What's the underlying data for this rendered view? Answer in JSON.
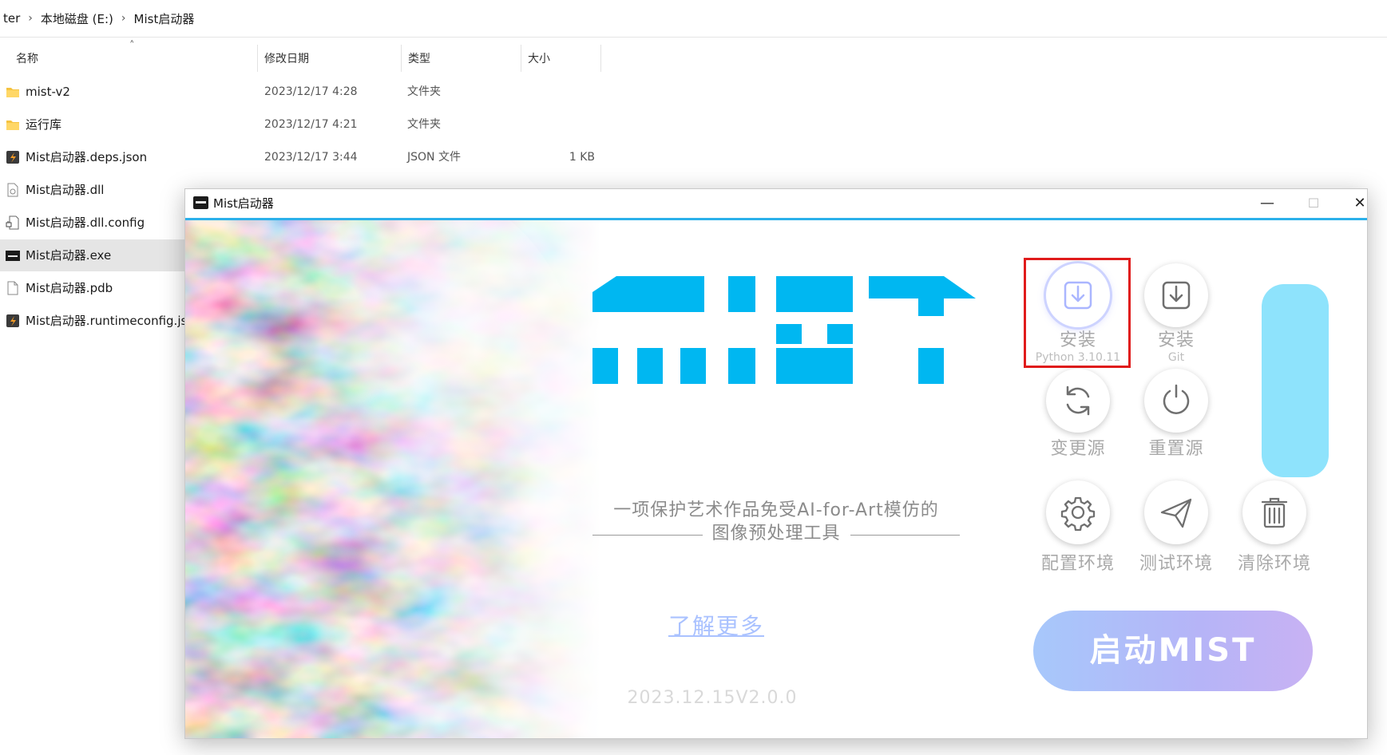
{
  "explorer": {
    "breadcrumb": [
      "ter",
      "本地磁盘 (E:)",
      "Mist启动器"
    ],
    "columns": {
      "name": "名称",
      "date": "修改日期",
      "type": "类型",
      "size": "大小"
    },
    "files": [
      {
        "name": "mist-v2",
        "date": "2023/12/17 4:28",
        "type": "文件夹",
        "size": "",
        "icon": "folder-icon"
      },
      {
        "name": "运行库",
        "date": "2023/12/17 4:21",
        "type": "文件夹",
        "size": "",
        "icon": "folder-icon"
      },
      {
        "name": "Mist启动器.deps.json",
        "date": "2023/12/17 3:44",
        "type": "JSON 文件",
        "size": "1 KB",
        "icon": "json-file-icon"
      },
      {
        "name": "Mist启动器.dll",
        "date": "",
        "type": "",
        "size": "",
        "icon": "dll-file-icon"
      },
      {
        "name": "Mist启动器.dll.config",
        "date": "",
        "type": "",
        "size": "",
        "icon": "config-file-icon"
      },
      {
        "name": "Mist启动器.exe",
        "date": "",
        "type": "",
        "size": "",
        "icon": "exe-file-icon"
      },
      {
        "name": "Mist启动器.pdb",
        "date": "",
        "type": "",
        "size": "",
        "icon": "pdb-file-icon"
      },
      {
        "name": "Mist启动器.runtimeconfig.js",
        "date": "",
        "type": "",
        "size": "",
        "icon": "json-file-icon"
      }
    ]
  },
  "launcher": {
    "title": "Mist启动器",
    "window_controls": {
      "minimize": "—",
      "maximize": "☐",
      "close": "✕"
    },
    "tagline_line1": "一项保护艺术作品免受AI-for-Art模仿的",
    "tagline_line2": "图像预处理工具",
    "learn_more": "了解更多",
    "version": "2023.12.15V2.0.0",
    "tools": [
      {
        "label": "安装",
        "sub": "Python 3.10.11",
        "icon": "download-icon"
      },
      {
        "label": "安装",
        "sub": "Git",
        "icon": "download-icon"
      },
      {
        "label": "变更源",
        "sub": "",
        "icon": "sync-icon"
      },
      {
        "label": "重置源",
        "sub": "",
        "icon": "reset-icon"
      },
      {
        "label": "配置环境",
        "sub": "",
        "icon": "gear-icon"
      },
      {
        "label": "测试环境",
        "sub": "",
        "icon": "paper-plane-icon"
      },
      {
        "label": "清除环境",
        "sub": "",
        "icon": "trash-icon"
      }
    ],
    "launch_button": "启动MIST",
    "colors": {
      "accent": "#2bb0ea",
      "logo": "#00b7f1",
      "highlight_border": "#e01b1b",
      "progress_fill": "#8ee3fc",
      "launch_gradient_start": "#a7c8fb",
      "launch_gradient_end": "#c8b2f3"
    }
  }
}
